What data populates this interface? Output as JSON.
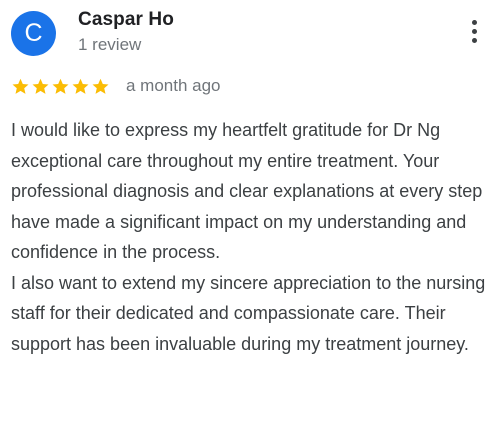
{
  "reviewer": {
    "initial": "C",
    "name": "Caspar Ho",
    "review_count": "1 review",
    "avatar_color": "#1a73e8"
  },
  "menu": {
    "icon": "more-vert-icon"
  },
  "rating": {
    "stars": 5,
    "max_stars": 5,
    "star_color": "#fbbc04",
    "date": "a month ago"
  },
  "review": {
    "paragraphs": [
      "I would like to express my heartfelt gratitude for Dr Ng exceptional care throughout my entire treatment. Your professional diagnosis and clear explanations at every step have made a significant impact on my understanding and confidence in the process.",
      "I also want to extend my sincere appreciation to the nursing staff for their dedicated and compassionate care. Their support has been invaluable during my treatment journey."
    ]
  }
}
